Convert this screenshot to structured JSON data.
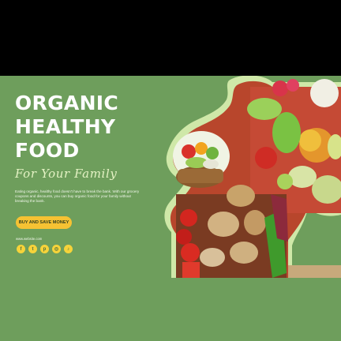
{
  "banner": {
    "headline_lines": [
      "ORGANIC",
      "HEALTHY",
      "FOOD"
    ],
    "script": "For Your Family",
    "body": "Eating organic, healthy food doesn't have to break the bank. With our grocery coupons and discounts, you can buy organic food for your family without breaking the bank.",
    "cta_label": "BUY AND SAVE MONEY",
    "website": "www.website.com",
    "socials": [
      {
        "icon": "facebook-icon",
        "glyph": "f"
      },
      {
        "icon": "twitter-icon",
        "glyph": "t"
      },
      {
        "icon": "pinterest-icon",
        "glyph": "p"
      },
      {
        "icon": "instagram-icon",
        "glyph": "◎"
      },
      {
        "icon": "tiktok-icon",
        "glyph": "♪"
      }
    ]
  },
  "colors": {
    "background": "#6e9e5c",
    "headline": "#ffffff",
    "script": "#e4f2c4",
    "button": "#f6c233",
    "social": "#f6d33a",
    "border": "#000000"
  },
  "images": [
    {
      "name": "vegetable-basket-photo",
      "content": "basket of vegetables and fruit"
    },
    {
      "name": "produce-collage-photo",
      "content": "fresh vegetables and fruit collage"
    }
  ]
}
